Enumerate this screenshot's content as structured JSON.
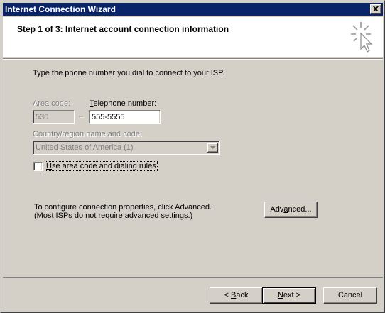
{
  "window": {
    "title": "Internet Connection Wizard",
    "close_icon": "close-x-icon"
  },
  "header": {
    "step_title": "Step 1 of 3: Internet account connection information",
    "icon": "wizard-cursor-sparkle-icon"
  },
  "body": {
    "instruction": "Type the phone number you dial to connect to your ISP.",
    "area_code_label": "Area code:",
    "area_code_value": "530",
    "dash": "–",
    "telephone_label_underlined": "T",
    "telephone_label_rest": "elephone number:",
    "telephone_value": "555-5555",
    "country_label": "Country/region name and code:",
    "country_value": "United States of America (1)",
    "checkbox_label_underlined": "U",
    "checkbox_label_rest": "se area code and dialing rules",
    "checkbox_checked": false,
    "advanced_text_line1": "To configure connection properties, click Advanced.",
    "advanced_text_line2": "(Most ISPs do not require advanced settings.)",
    "advanced_button_pre": "Adv",
    "advanced_button_underlined": "a",
    "advanced_button_post": "nced..."
  },
  "footer": {
    "back_prefix": "< ",
    "back_underlined": "B",
    "back_rest": "ack",
    "next_underlined": "N",
    "next_rest": "ext >",
    "cancel_label": "Cancel"
  },
  "colors": {
    "titlebar": "#0a246a",
    "face": "#d4d0c8",
    "disabled_text": "#808080"
  }
}
